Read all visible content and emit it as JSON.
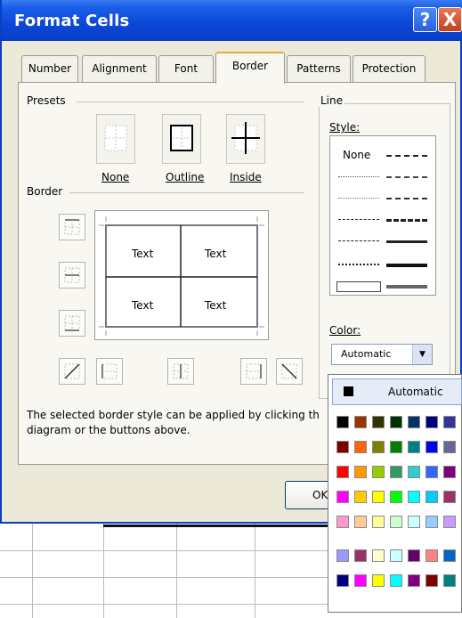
{
  "window": {
    "title": "Format Cells",
    "help_glyph": "?",
    "close_glyph": "X"
  },
  "tabs": [
    {
      "label": "Number",
      "active": false
    },
    {
      "label": "Alignment",
      "active": false
    },
    {
      "label": "Font",
      "active": false
    },
    {
      "label": "Border",
      "active": true
    },
    {
      "label": "Patterns",
      "active": false
    },
    {
      "label": "Protection",
      "active": false
    }
  ],
  "presets": {
    "group_label": "Presets",
    "buttons": [
      {
        "label": "None",
        "icon": "preset-none-icon"
      },
      {
        "label": "Outline",
        "icon": "preset-outline-icon"
      },
      {
        "label": "Inside",
        "icon": "preset-inside-icon"
      }
    ]
  },
  "border": {
    "group_label": "Border",
    "preview_texts": [
      "Text",
      "Text",
      "Text",
      "Text"
    ]
  },
  "line": {
    "group_label": "Line",
    "style_label": "Style:",
    "none_option": "None",
    "color_label": "Color:",
    "color_value": "Automatic"
  },
  "note": "The selected border style can be applied by clicking th diagram or the buttons above.",
  "buttons": {
    "ok": "OK"
  },
  "palette": {
    "automatic_label": "Automatic",
    "rows": [
      [
        "#000000",
        "#993300",
        "#333300",
        "#003300",
        "#003366",
        "#000080",
        "#333399"
      ],
      [
        "#800000",
        "#FF6600",
        "#808000",
        "#008000",
        "#008080",
        "#0000FF",
        "#666699"
      ],
      [
        "#FF0000",
        "#FF9900",
        "#99CC00",
        "#339966",
        "#33CCCC",
        "#3366FF",
        "#800080"
      ],
      [
        "#FF00FF",
        "#FFCC00",
        "#FFFF00",
        "#00FF00",
        "#00FFFF",
        "#00CCFF",
        "#993366"
      ],
      [
        "#FF99CC",
        "#FFCC99",
        "#FFFF99",
        "#CCFFCC",
        "#CCFFFF",
        "#99CCFF",
        "#CC99FF"
      ],
      [
        "#9999FF",
        "#993366",
        "#FFFFCC",
        "#CCFFFF",
        "#660066",
        "#FF8080",
        "#0066CC"
      ],
      [
        "#000080",
        "#FF00FF",
        "#FFFF00",
        "#00FFFF",
        "#800080",
        "#800000",
        "#008080"
      ]
    ]
  }
}
